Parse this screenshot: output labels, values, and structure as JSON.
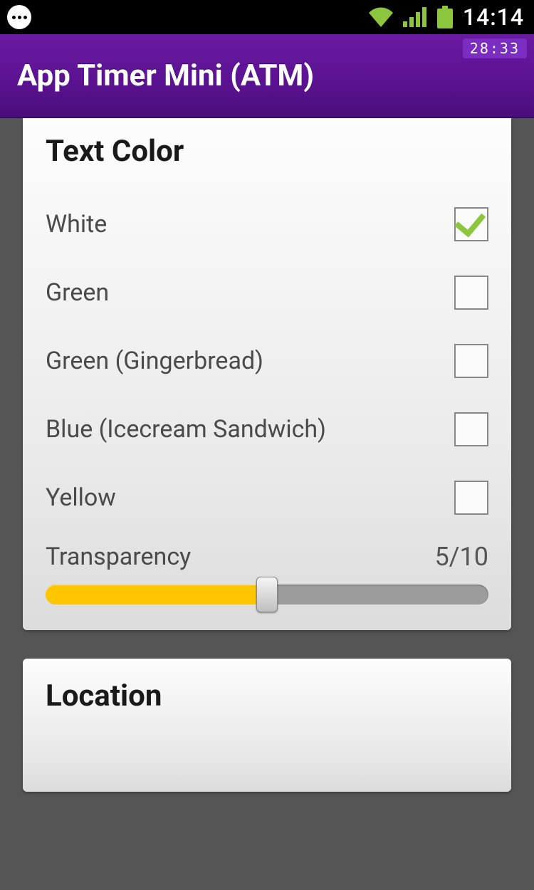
{
  "status": {
    "time": "14:14"
  },
  "app": {
    "title": "App Timer Mini (ATM)",
    "badge": "28:33"
  },
  "sections": {
    "text_color": {
      "title": "Text Color",
      "options": [
        {
          "label": "White",
          "checked": true
        },
        {
          "label": "Green",
          "checked": false
        },
        {
          "label": "Green (Gingerbread)",
          "checked": false
        },
        {
          "label": "Blue (Icecream Sandwich)",
          "checked": false
        },
        {
          "label": "Yellow",
          "checked": false
        }
      ],
      "transparency": {
        "label": "Transparency",
        "value_text": "5/10",
        "value": 5,
        "max": 10
      }
    },
    "location": {
      "title": "Location"
    }
  }
}
